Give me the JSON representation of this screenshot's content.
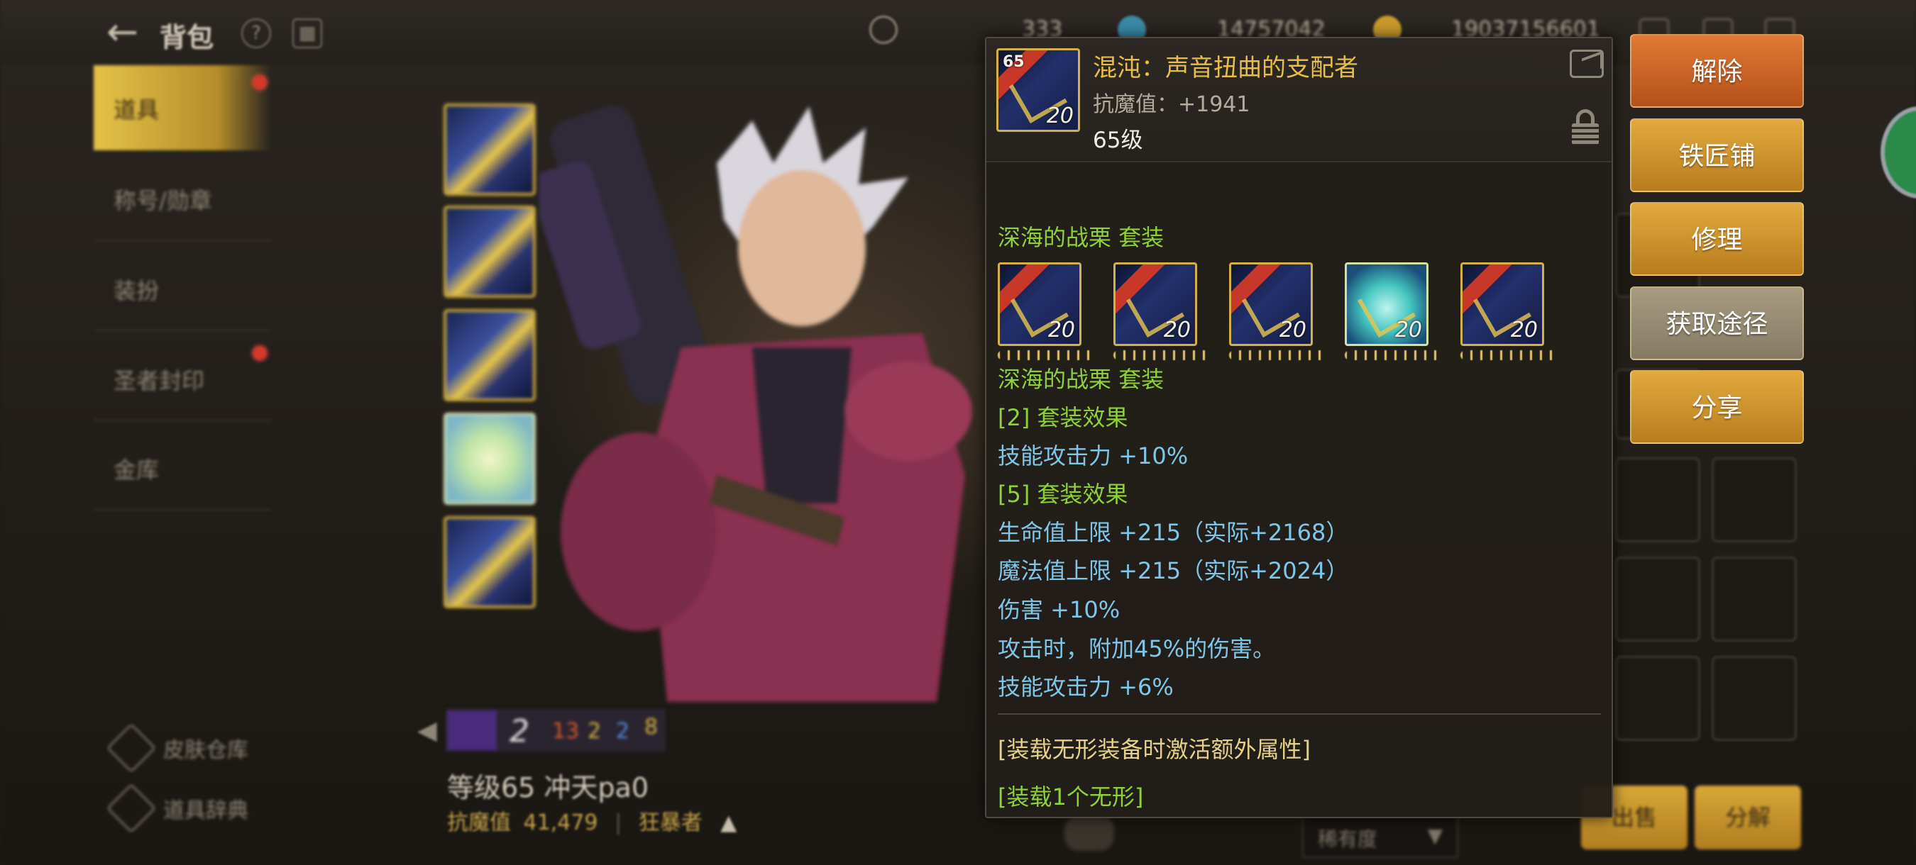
{
  "header": {
    "title": "背包",
    "currencies": [
      {
        "icon": "moon-coin-icon",
        "value": "333"
      },
      {
        "icon": "feather-icon",
        "value": "14757042"
      },
      {
        "icon": "gold-coin-icon",
        "value": "19037156601"
      }
    ]
  },
  "sidebar": {
    "items": [
      {
        "label": "道具",
        "active": true,
        "badge": true
      },
      {
        "label": "称号/勋章",
        "active": false,
        "badge": false
      },
      {
        "label": "装扮",
        "active": false,
        "badge": false
      },
      {
        "label": "圣者封印",
        "active": false,
        "badge": true
      },
      {
        "label": "金库",
        "active": false,
        "badge": false
      }
    ],
    "bottom": [
      {
        "label": "皮肤仓库",
        "icon": "skin-warehouse-icon"
      },
      {
        "label": "道具辞典",
        "icon": "item-dictionary-icon"
      }
    ]
  },
  "character": {
    "stats": [
      "2",
      "13",
      "2",
      "2",
      "8"
    ],
    "name": "等级65 冲天pa0",
    "power_label": "抗魔值",
    "power_value": "41,479",
    "class": "狂暴者"
  },
  "tooltip": {
    "item_name": "混沌：声音扭曲的支配者",
    "stat": "抗魔值：+1941",
    "level": "65级",
    "icon_level": "20",
    "icon_tag": "65",
    "set_name_1": "深海的战栗  套装",
    "set_items": [
      {
        "level": "20",
        "style": "dark"
      },
      {
        "level": "20",
        "style": "dark"
      },
      {
        "level": "20",
        "style": "dark"
      },
      {
        "level": "20",
        "style": "teal"
      },
      {
        "level": "20",
        "style": "dark"
      }
    ],
    "set_name_2": "深海的战栗  套装",
    "effect2_title": "[2] 套装效果",
    "effect2_lines": [
      "技能攻击力 +10%"
    ],
    "effect5_title": "[5] 套装效果",
    "effect5_lines": [
      "生命值上限 +215（实际+2168）",
      "魔法值上限 +215（实际+2024）",
      "伤害 +10%",
      "攻击时，附加45%的伤害。",
      "技能攻击力 +6%"
    ],
    "bonus_note": "[装载无形装备时激活额外属性]",
    "bonus_req": "[装载1个无形]"
  },
  "actions": {
    "release": "解除",
    "blacksmith": "铁匠铺",
    "repair": "修理",
    "obtain": "获取途径",
    "share": "分享"
  },
  "bottom": {
    "rarity": "稀有度",
    "sell": "出售",
    "disassemble": "分解"
  },
  "colors": {
    "title_gold": "#e8bd4a",
    "set_green": "#8fd13c",
    "effect_blue": "#7fc6e8",
    "note_yellow": "#e6d08a",
    "btn_orange": "#c8622a",
    "btn_gold": "#d09530",
    "btn_grey": "#968b72"
  }
}
